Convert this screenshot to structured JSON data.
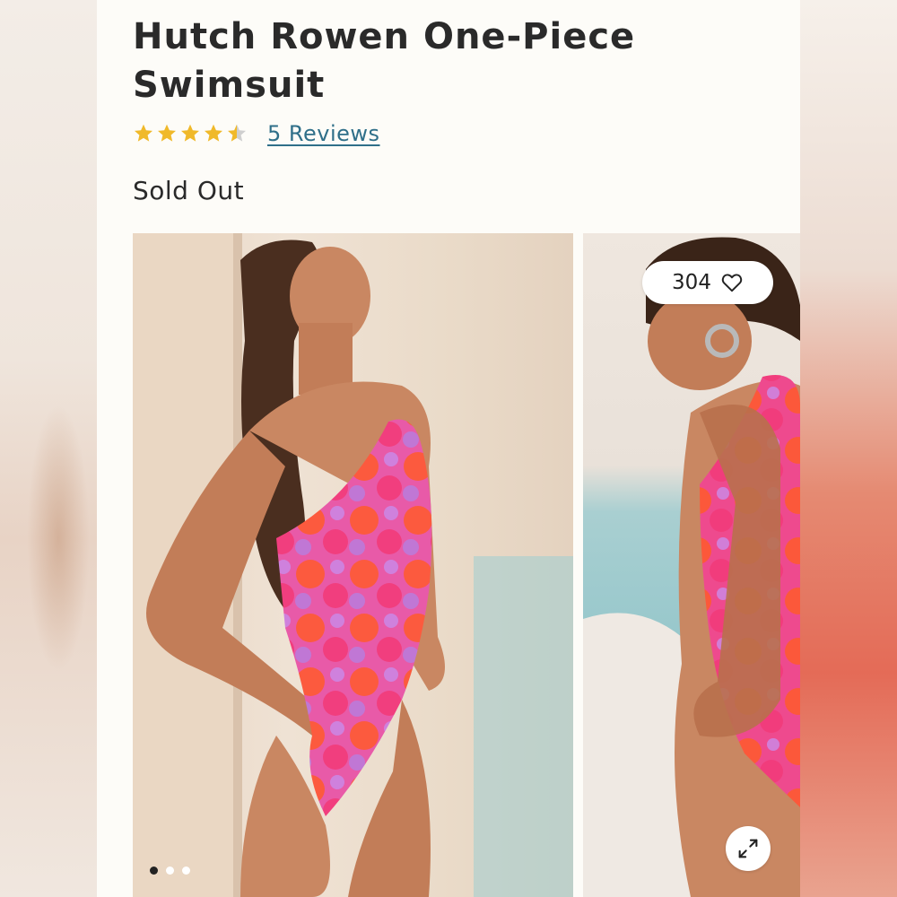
{
  "product": {
    "title_line1": "Hutch Rowen One-Piece",
    "title_line2": "Swimsuit",
    "rating": 4.5,
    "rating_max": 5,
    "reviews_label": "5 Reviews",
    "status": "Sold Out"
  },
  "gallery": {
    "likes_count": "304",
    "likes_icon": "heart-outline-icon",
    "expand_icon": "expand-arrows-icon",
    "image_count": 3,
    "active_index": 0
  },
  "colors": {
    "star": "#f0b92a",
    "star_empty": "#cfcfcf",
    "link": "#2f6f89",
    "text": "#2a2a2a"
  }
}
